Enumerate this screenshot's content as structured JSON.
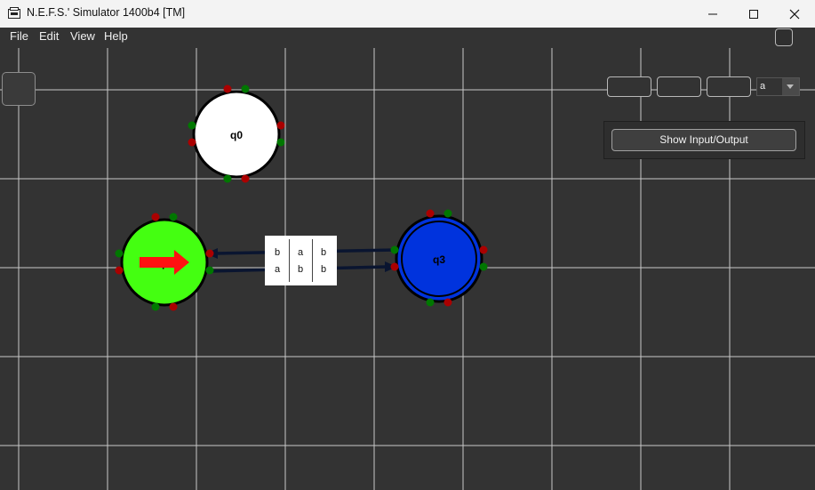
{
  "window": {
    "title": "N.E.F.S.' Simulator 1400b4 [TM]",
    "controls": [
      "minimize",
      "maximize",
      "close"
    ]
  },
  "menu": [
    {
      "label": "File"
    },
    {
      "label": "Edit"
    },
    {
      "label": "View"
    },
    {
      "label": "Help"
    }
  ],
  "toolbar": {
    "alphabet_select_value": "a",
    "show_io_label": "Show Input/Output"
  },
  "states": [
    {
      "label": "q0",
      "fill": "#ffffff",
      "role": "normal"
    },
    {
      "label": "q2",
      "fill": "#44ff11",
      "role": "initial"
    },
    {
      "label": "q3",
      "fill": "#0033dd",
      "role": "accepting"
    }
  ],
  "transition_label": {
    "rows": [
      [
        "b",
        "a",
        "b"
      ],
      [
        "a",
        "b",
        "b"
      ]
    ]
  },
  "colors": {
    "background": "#333333",
    "grid": "#c8c8c8",
    "titlebar": "#f3f3f3",
    "arrow": "#0a1530",
    "connector_red": "#aa0000",
    "connector_green": "#007700",
    "initial_arrow": "#ff1111"
  }
}
